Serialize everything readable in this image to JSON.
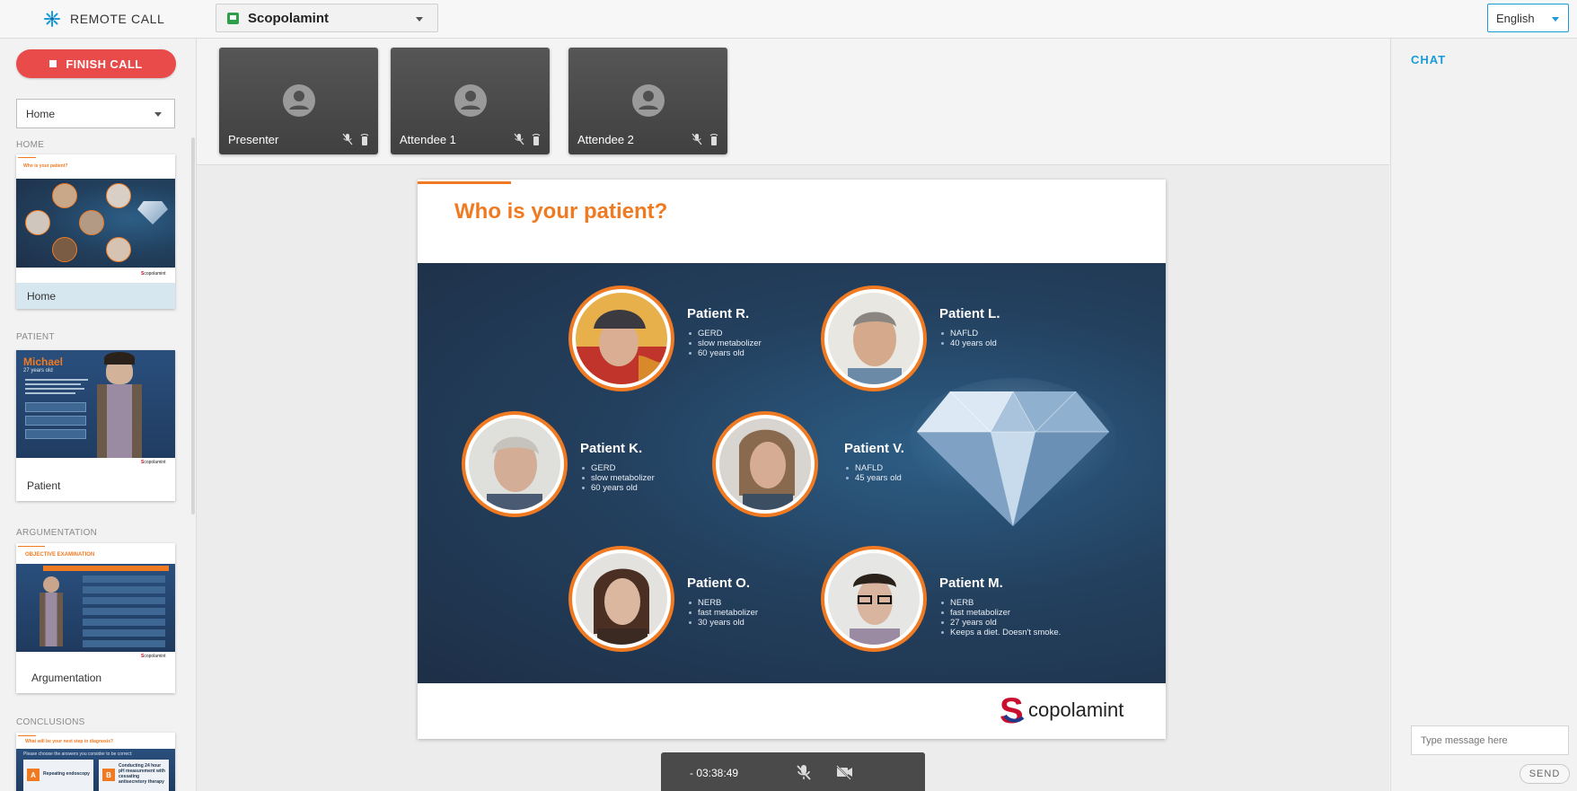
{
  "app": {
    "title": "REMOTE CALL"
  },
  "product_select": {
    "value": "Scopolamint"
  },
  "language_select": {
    "value": "English"
  },
  "sidebar": {
    "finish_label": "FINISH CALL",
    "nav_select_value": "Home",
    "sections": [
      {
        "label": "HOME",
        "card_title": "Home",
        "thumb_heading": "Who is your patient?"
      },
      {
        "label": "PATIENT",
        "card_title": "Patient",
        "thumb_heading": "Michael",
        "thumb_sub": "27 years old"
      },
      {
        "label": "ARGUMENTATION",
        "card_title": "Argumentation",
        "thumb_heading": "OBJECTIVE EXAMINATION"
      },
      {
        "label": "CONCLUSIONS",
        "thumb_heading": "What will be your next step in diagnosis?",
        "thumb_sub": "Please choose the answers you consider to be correct:",
        "option_a_letter": "A",
        "option_a": "Repeating endoscopy",
        "option_b_letter": "B",
        "option_b": "Conducting 24 hour pH measurement with cessating antisecretory therapy"
      }
    ]
  },
  "videos": [
    {
      "name": "Presenter"
    },
    {
      "name": "Attendee 1"
    },
    {
      "name": "Attendee 2"
    }
  ],
  "slide": {
    "title": "Who is your patient?",
    "patients": [
      {
        "name": "Patient R.",
        "items": [
          "GERD",
          "slow metabolizer",
          "60 years old"
        ]
      },
      {
        "name": "Patient L.",
        "items": [
          "NAFLD",
          "40 years old"
        ]
      },
      {
        "name": "Patient K.",
        "items": [
          "GERD",
          "slow metabolizer",
          "60 years old"
        ]
      },
      {
        "name": "Patient V.",
        "items": [
          "NAFLD",
          "45 years old"
        ]
      },
      {
        "name": "Patient O.",
        "items": [
          "NERB",
          "fast metabolizer",
          "30 years old"
        ]
      },
      {
        "name": "Patient M.",
        "items": [
          "NERB",
          "fast metabolizer",
          "27 years old",
          "Keeps a diet. Doesn't smoke."
        ]
      }
    ],
    "logo_letter": "S",
    "logo_text": "copolamint",
    "logo_text_full": "Scopolamint"
  },
  "controls": {
    "time": "- 03:38:49"
  },
  "chat": {
    "title": "CHAT",
    "input_placeholder": "Type message here",
    "send_label": "SEND"
  },
  "colors": {
    "accent": "#f07a22",
    "finish": "#e94b4b",
    "link": "#1a9bd7",
    "slide_bg": "#23405e",
    "tile": "#4a4a4a"
  },
  "icons": [
    "remote-call-logo-icon",
    "chevron-down-icon",
    "stop-icon",
    "person-icon",
    "mic-off-icon",
    "mobile-signal-icon",
    "camera-off-icon"
  ]
}
